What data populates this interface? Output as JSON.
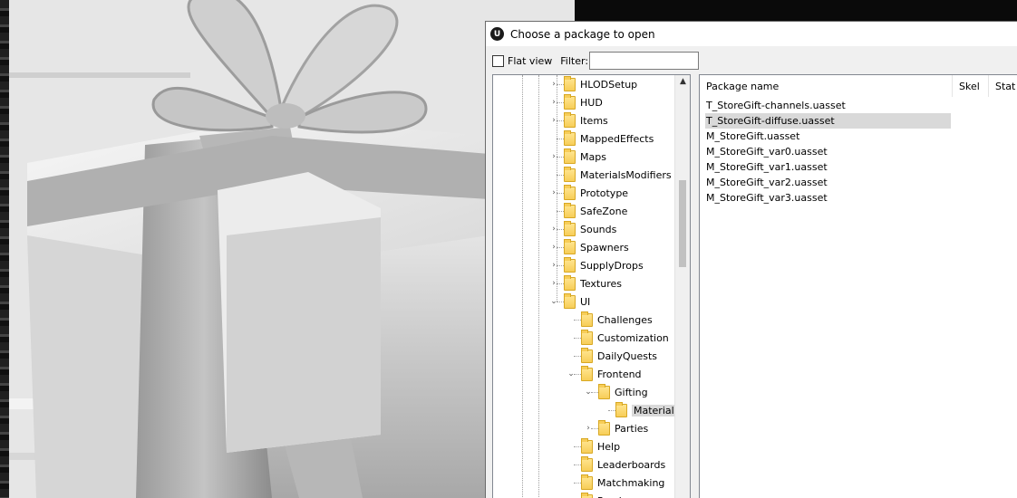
{
  "dialog": {
    "title": "Choose a package to open",
    "app_icon": "U",
    "flat_view_label": "Flat view",
    "flat_view_checked": false,
    "filter_label": "Filter:",
    "filter_value": ""
  },
  "tree": {
    "nodes": [
      {
        "label": "HLODSetup",
        "expander": "›",
        "level": 0
      },
      {
        "label": "HUD",
        "expander": "›",
        "level": 0
      },
      {
        "label": "Items",
        "expander": "›",
        "level": 0
      },
      {
        "label": "MappedEffects",
        "expander": "",
        "level": 0
      },
      {
        "label": "Maps",
        "expander": "›",
        "level": 0
      },
      {
        "label": "MaterialsModifiers",
        "expander": "",
        "level": 0
      },
      {
        "label": "Prototype",
        "expander": "›",
        "level": 0
      },
      {
        "label": "SafeZone",
        "expander": "",
        "level": 0
      },
      {
        "label": "Sounds",
        "expander": "›",
        "level": 0
      },
      {
        "label": "Spawners",
        "expander": "›",
        "level": 0
      },
      {
        "label": "SupplyDrops",
        "expander": "›",
        "level": 0
      },
      {
        "label": "Textures",
        "expander": "›",
        "level": 0
      },
      {
        "label": "UI",
        "expander": "⌄",
        "level": 0
      },
      {
        "label": "Challenges",
        "expander": "",
        "level": 1
      },
      {
        "label": "Customization",
        "expander": "",
        "level": 1
      },
      {
        "label": "DailyQuests",
        "expander": "",
        "level": 1
      },
      {
        "label": "Frontend",
        "expander": "⌄",
        "level": 1
      },
      {
        "label": "Gifting",
        "expander": "⌄",
        "level": 2
      },
      {
        "label": "Materials",
        "expander": "",
        "level": 3,
        "selected": true
      },
      {
        "label": "Parties",
        "expander": "›",
        "level": 2
      },
      {
        "label": "Help",
        "expander": "",
        "level": 1
      },
      {
        "label": "Leaderboards",
        "expander": "",
        "level": 1
      },
      {
        "label": "Matchmaking",
        "expander": "",
        "level": 1
      },
      {
        "label": "Purchase",
        "expander": "",
        "level": 1
      }
    ],
    "scroll_up_icon": "▲"
  },
  "list": {
    "columns": [
      "Package name",
      "Skel",
      "Stat"
    ],
    "rows": [
      {
        "name": "T_StoreGift-channels.uasset",
        "selected": false
      },
      {
        "name": "T_StoreGift-diffuse.uasset",
        "selected": true
      },
      {
        "name": "M_StoreGift.uasset",
        "selected": false
      },
      {
        "name": "M_StoreGift_var0.uasset",
        "selected": false
      },
      {
        "name": "M_StoreGift_var1.uasset",
        "selected": false
      },
      {
        "name": "M_StoreGift_var2.uasset",
        "selected": false
      },
      {
        "name": "M_StoreGift_var3.uasset",
        "selected": false
      }
    ]
  }
}
